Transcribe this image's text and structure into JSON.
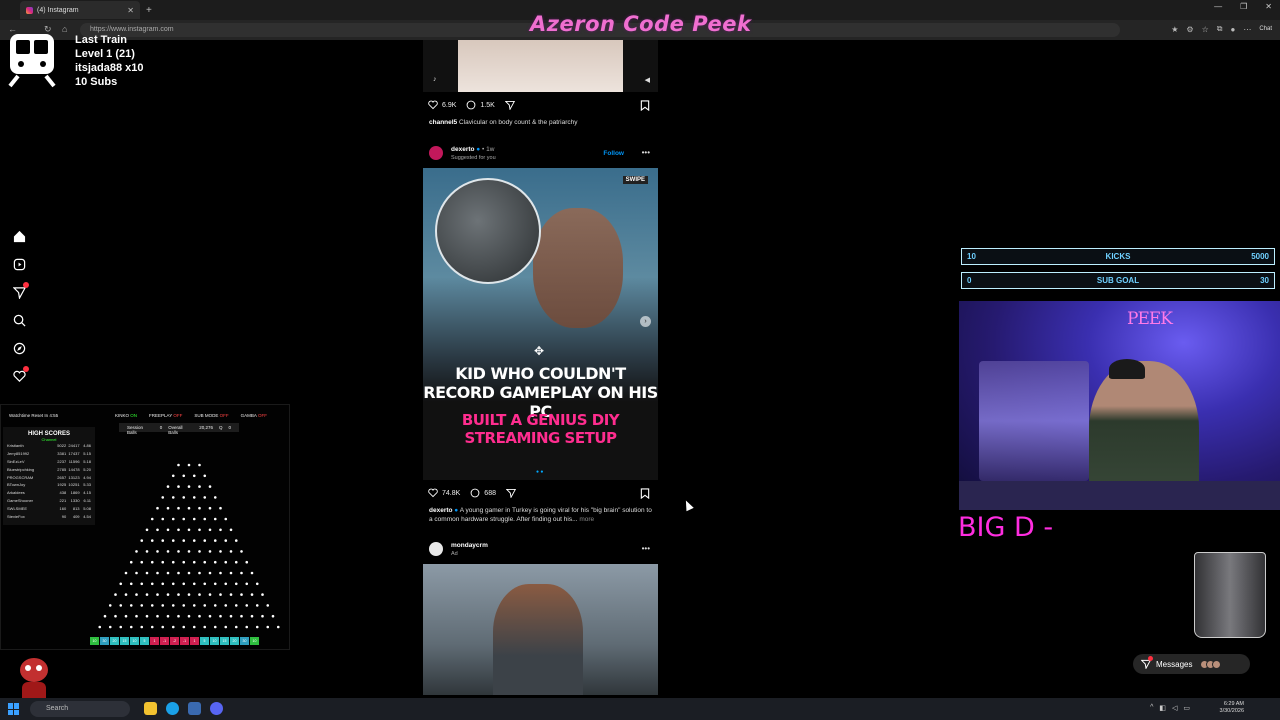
{
  "browser": {
    "tab_title": "(4) Instagram",
    "url": "https://www.instagram.com",
    "chat_label": "Chat"
  },
  "overlay": {
    "title": "Azeron Code Peek"
  },
  "train": {
    "line1": "Last Train",
    "line2": "Level 1  (21)",
    "line3": "itsjada88 x10",
    "line4": "10 Subs"
  },
  "nav": {
    "notification_count": "4"
  },
  "feed": {
    "post1": {
      "likes": "6.9K",
      "comments": "1.5K",
      "caption_user": "channel5",
      "caption_text": "Clavicular on body count & the patriarchy"
    },
    "post2": {
      "username": "dexerto",
      "time": "1w",
      "subtitle": "Suggested for you",
      "follow_label": "Follow",
      "swipe_label": "SWIPE",
      "headline1": "KID WHO COULDN'T RECORD GAMEPLAY ON HIS PC",
      "headline2": "BUILT A GENIUS DIY STREAMING SETUP",
      "likes": "74.8K",
      "comments": "688",
      "caption_user": "dexerto",
      "caption_text": "A young gamer in Turkey is going viral for his \"big brain\" solution to a common hardware struggle. After finding out his...",
      "more_label": "more"
    },
    "post3": {
      "username": "mondaycrm",
      "subtitle": "Ad"
    }
  },
  "plinko": {
    "watchtime": "Watchtime Reset In 4:55",
    "modes": [
      {
        "label": "KINKO",
        "state": "ON"
      },
      {
        "label": "FREEPLAY",
        "state": "OFF"
      },
      {
        "label": "SUB MODE",
        "state": "OFF"
      },
      {
        "label": "GAMBA",
        "state": "OFF"
      }
    ],
    "session_balls_label": "Session Balls",
    "session_balls": "0",
    "overall_balls_label": "Overall Balls",
    "overall_balls": "20,276",
    "q_label": "Q",
    "q_value": "0",
    "high_scores_title": "HIGH SCORES",
    "high_scores_sub": "Channel",
    "scores": [
      {
        "name": "Kristianth",
        "a": "5022",
        "b": "24417",
        "c": "4.86"
      },
      {
        "name": "Jerry851992",
        "a": "3381",
        "b": "17437",
        "c": "5.15"
      },
      {
        "name": "SinEzLeV",
        "a": "2237",
        "b": "11596",
        "c": "5.18"
      },
      {
        "name": "Bluestripchking",
        "a": "2785",
        "b": "14478",
        "c": "5.20"
      },
      {
        "name": "PROGSCRAM",
        "a": "2657",
        "b": "13123",
        "c": "4.94"
      },
      {
        "name": "BTownJoy",
        "a": "1925",
        "b": "10251",
        "c": "5.33"
      },
      {
        "name": "Arkaldees",
        "a": "438",
        "b": "1869",
        "c": "4.15"
      },
      {
        "name": "GameShooner",
        "a": "221",
        "b": "1330",
        "c": "6.11"
      },
      {
        "name": "SWLSMEE",
        "a": "160",
        "b": "813",
        "c": "5.08"
      },
      {
        "name": "StevieFox",
        "a": "90",
        "b": "409",
        "c": "4.54"
      }
    ],
    "slots": [
      "10",
      "30",
      "20",
      "15",
      "10",
      "5",
      "1",
      "-1",
      "-2",
      "-1",
      "1",
      "5",
      "10",
      "15",
      "20",
      "30",
      "10"
    ],
    "slot_colors": [
      "#2fbf3f",
      "#2f9fbf",
      "#2fbfbf",
      "#2fbfbf",
      "#2fbfbf",
      "#2fbfbf",
      "#d02050",
      "#d02050",
      "#d02050",
      "#d02050",
      "#d02050",
      "#2fbfbf",
      "#2fbfbf",
      "#2fbfbf",
      "#2fbfbf",
      "#2f9fbf",
      "#2fbf3f"
    ]
  },
  "goals": {
    "kicks": {
      "left": "10",
      "label": "KICKS",
      "right": "5000"
    },
    "subs": {
      "left": "0",
      "label": "SUB GOAL",
      "right": "30"
    }
  },
  "webcam": {
    "peek_label": "PEEK"
  },
  "bigd": "BIG D -",
  "messages": {
    "label": "Messages"
  },
  "taskbar": {
    "search_placeholder": "Search",
    "time": "6:29 AM",
    "date": "3/30/2026"
  },
  "colors": {
    "accent_pink": "#f06fd0",
    "goal_cyan": "#6fd0ff",
    "ig_blue": "#0095f6",
    "headline_pink": "#ff2d8f"
  }
}
